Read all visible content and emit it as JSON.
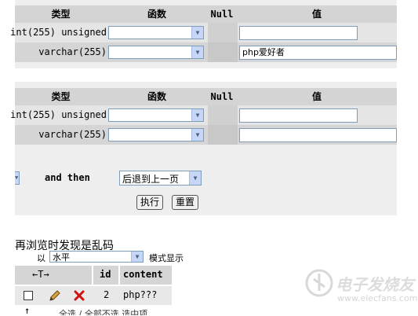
{
  "table1": {
    "headers": {
      "type": "类型",
      "function": "函数",
      "null": "Null",
      "value": "值"
    },
    "rows": [
      {
        "type": "int(255) unsigned",
        "value": ""
      },
      {
        "type": "varchar(255)",
        "value": "php爱好者"
      }
    ]
  },
  "table2": {
    "headers": {
      "type": "类型",
      "function": "函数",
      "null": "Null",
      "value": "值"
    },
    "rows": [
      {
        "type": "int(255) unsigned",
        "value": ""
      },
      {
        "type": "varchar(255)",
        "value": ""
      }
    ]
  },
  "footer": {
    "and_then": "and then",
    "goback_option": "后退到上一页",
    "execute_label": "执行",
    "reset_label": "重置"
  },
  "caption": "再浏览时发现是乱码",
  "browse": {
    "display_mode": "水平",
    "mode_label": "模式显示",
    "sort_arrows": "←T→",
    "columns": [
      "id",
      "content"
    ],
    "row": {
      "id": "2",
      "content": "php???"
    },
    "bottom_links": "全选 / 全部不选  选中项"
  },
  "watermark": "电子发烧友",
  "watermark_url": "www.elecfans.com"
}
